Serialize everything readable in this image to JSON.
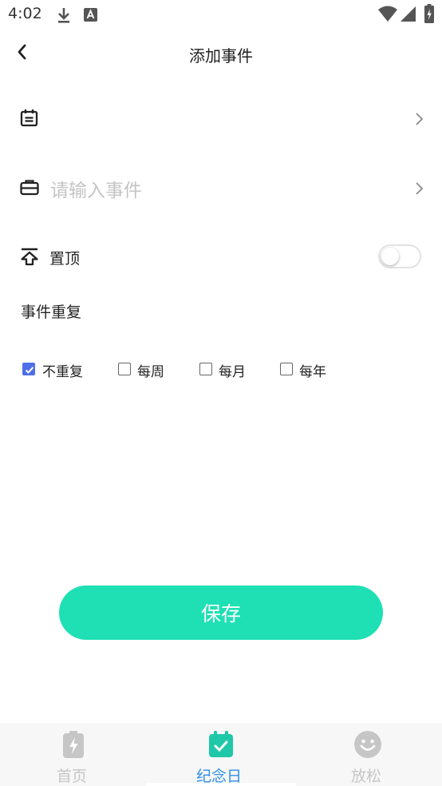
{
  "status_bar": {
    "time": "4:02",
    "left_icons": [
      "download-icon",
      "a-badge-icon"
    ],
    "right_icons": [
      "wifi-icon",
      "signal-icon",
      "battery-charging-icon"
    ]
  },
  "header": {
    "title": "添加事件",
    "back_icon": "chevron-left-icon"
  },
  "form": {
    "date_row": {
      "icon": "calendar-icon",
      "value": "",
      "chevron_icon": "chevron-right-icon"
    },
    "event_row": {
      "icon": "briefcase-icon",
      "placeholder": "请输入事件",
      "chevron_icon": "chevron-right-icon"
    },
    "pin_row": {
      "icon": "pin-top-icon",
      "label": "置顶",
      "enabled": false
    },
    "repeat_section": {
      "title": "事件重复",
      "options": [
        {
          "label": "不重复",
          "checked": true
        },
        {
          "label": "每周",
          "checked": false
        },
        {
          "label": "每月",
          "checked": false
        },
        {
          "label": "每年",
          "checked": false
        }
      ]
    }
  },
  "save_button": {
    "label": "保存"
  },
  "tab_bar": {
    "tabs": [
      {
        "label": "首页",
        "icon": "battery-bolt-icon",
        "active": false
      },
      {
        "label": "纪念日",
        "icon": "calendar-check-icon",
        "active": true
      },
      {
        "label": "放松",
        "icon": "smile-icon",
        "active": false
      }
    ]
  },
  "colors": {
    "accent": "#1ee0b4",
    "active_tab": "#2d8fe8",
    "inactive_tab": "#c6c6c6",
    "checkbox_checked": "#4f6ee8",
    "placeholder": "#c4c4c4"
  }
}
